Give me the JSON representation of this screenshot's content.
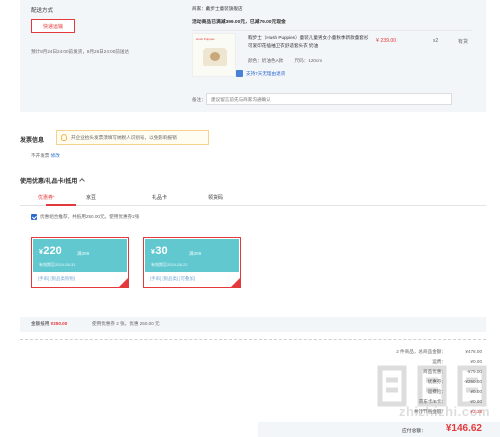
{
  "shipping": {
    "title": "配送方式",
    "method": "快递运输",
    "note": "预计8月24日24:00前发货，8月26日24:00前送达"
  },
  "shop": {
    "seller_label": "商家：",
    "seller_name": "戴步士童装旗舰店",
    "promo": "活动商品已满减399.00元，已减79.00元现金"
  },
  "item": {
    "brand_mark": "Hush Puppies",
    "name": "暇步士（Hush Puppies）童装儿童男女小童秋季新款童套衫可爱印花插袖卫衣舒适套头衣 奶油",
    "color": "颜色：奶油色A款",
    "size": "尺码：120cm",
    "service": "支持7天无理由退货",
    "price": "¥ 239.00",
    "qty": "x2",
    "stock": "有货"
  },
  "remark": {
    "label": "备注：",
    "placeholder": "建议留言前先与商家沟通确认"
  },
  "invoice": {
    "title": "发票信息",
    "tip": "开企业抬头发票须填写纳税人识别号，以免影响报销",
    "current": "不开发票",
    "edit": "修改"
  },
  "coupons": {
    "title": "使用优惠/礼品卡/抵用",
    "tabs": [
      "优惠券",
      "京豆",
      "礼品卡",
      "领货码"
    ],
    "active_tab": 0,
    "merge_text": "优惠组合推荐，共抵用250.00元。使用优惠券2张",
    "items": [
      {
        "currency": "¥",
        "amount": "220",
        "condition": "满399",
        "valid": "有效期至2024-08-31",
        "tags": "[手串] [限品类购物]"
      },
      {
        "currency": "¥",
        "amount": "30",
        "condition": "满399",
        "valid": "有效期至2024-08-22",
        "tags": "[手串] [限品类] [可叠加]"
      }
    ]
  },
  "discount_summary": {
    "label": "金额抵用",
    "amount": "¥250.00",
    "detail": "使用优惠券 2 张，优惠 250.00 元"
  },
  "totals": [
    {
      "label": "2 件商品，总商品金额：",
      "value": "¥478.00",
      "red": false
    },
    {
      "label": "运费：",
      "value": "¥0.00",
      "red": false
    },
    {
      "label": "商品优惠：",
      "value": "-¥79.00",
      "red": false
    },
    {
      "label": "优惠券：",
      "value": "-¥250.00",
      "red": false
    },
    {
      "label": "运费险：",
      "value": "¥0.00",
      "red": false
    },
    {
      "label": "京东卡/E卡：",
      "value": "-¥0.00",
      "red": false
    },
    {
      "label": "共计节省金额：",
      "value": "¥2.38",
      "red": true
    }
  ],
  "payable": {
    "label": "应付总额：",
    "value": "¥146.62"
  },
  "watermark": "zhizhizhi.com"
}
